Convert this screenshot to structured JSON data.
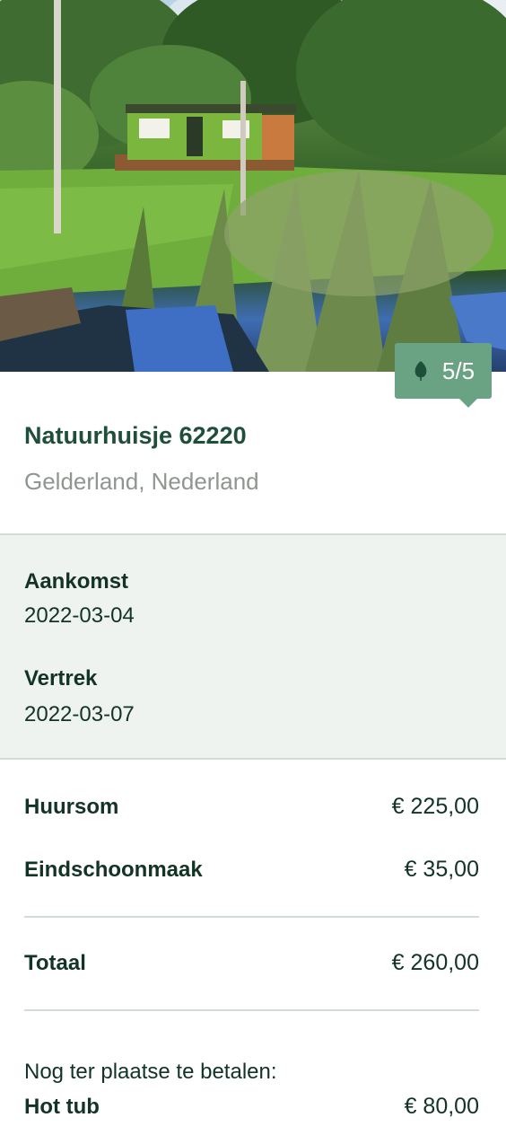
{
  "listing": {
    "title": "Natuurhuisje 62220",
    "location": "Gelderland, Nederland",
    "rating": "5/5",
    "rating_icon": "leaf-icon"
  },
  "dates": {
    "arrival_label": "Aankomst",
    "arrival_value": "2022-03-04",
    "departure_label": "Vertrek",
    "departure_value": "2022-03-07"
  },
  "costs": {
    "items": [
      {
        "label": "Huursom",
        "amount": "€ 225,00"
      },
      {
        "label": "Eindschoonmaak",
        "amount": "€ 35,00"
      }
    ],
    "total_label": "Totaal",
    "total_amount": "€ 260,00",
    "onsite_note": "Nog ter plaatse te betalen:",
    "onsite_items": [
      {
        "label": "Hot tub",
        "amount": "€ 80,00"
      }
    ]
  },
  "colors": {
    "brand_green": "#1f4f3b",
    "badge_green": "#6aa383",
    "section_bg": "#eff3f0",
    "muted_text": "#8f9590"
  }
}
